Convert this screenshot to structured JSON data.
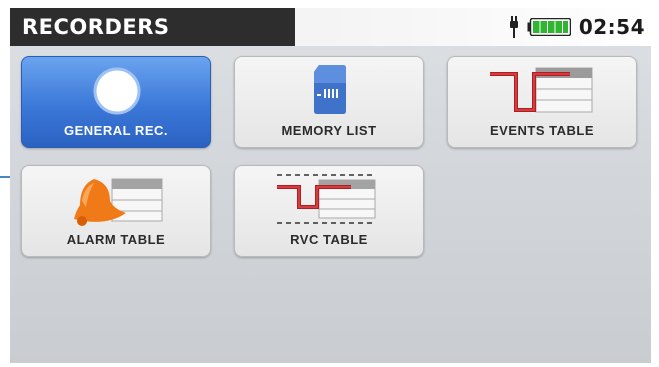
{
  "header": {
    "title": "RECORDERS",
    "time": "02:54",
    "battery_icon": "battery-full-icon",
    "power_icon": "plug-icon"
  },
  "menu": {
    "items": [
      {
        "label": "GENERAL REC.",
        "icon": "record-icon",
        "selected": true
      },
      {
        "label": "MEMORY LIST",
        "icon": "memory-card-icon",
        "selected": false
      },
      {
        "label": "EVENTS TABLE",
        "icon": "events-table-icon",
        "selected": false
      },
      {
        "label": "ALARM TABLE",
        "icon": "alarm-bell-icon",
        "selected": false
      },
      {
        "label": "RVC TABLE",
        "icon": "rvc-table-icon",
        "selected": false
      }
    ]
  },
  "colors": {
    "accent": "#3b78d8",
    "title_bar": "#2d2d2d",
    "battery": "#2fb52f",
    "event_line": "#c0282a",
    "bell": "#f07a18"
  }
}
